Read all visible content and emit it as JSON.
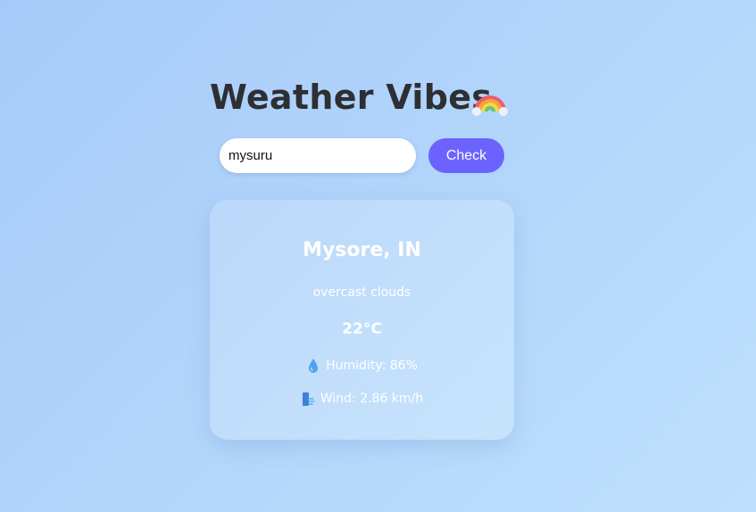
{
  "app": {
    "title": "Weather Vibes",
    "title_icon": "rainbow-icon"
  },
  "search": {
    "value": "mysuru",
    "placeholder": "",
    "button_label": "Check"
  },
  "weather": {
    "city": "Mysore, IN",
    "description": "overcast clouds",
    "temperature": "22°C",
    "humidity_icon": "droplet-icon",
    "humidity": "Humidity: 86%",
    "wind_icon": "wind-icon",
    "wind": "Wind: 2.86 km/h"
  },
  "colors": {
    "accent": "#6c63ff",
    "title_text": "#2e2f33",
    "card_text": "#ffffff"
  }
}
